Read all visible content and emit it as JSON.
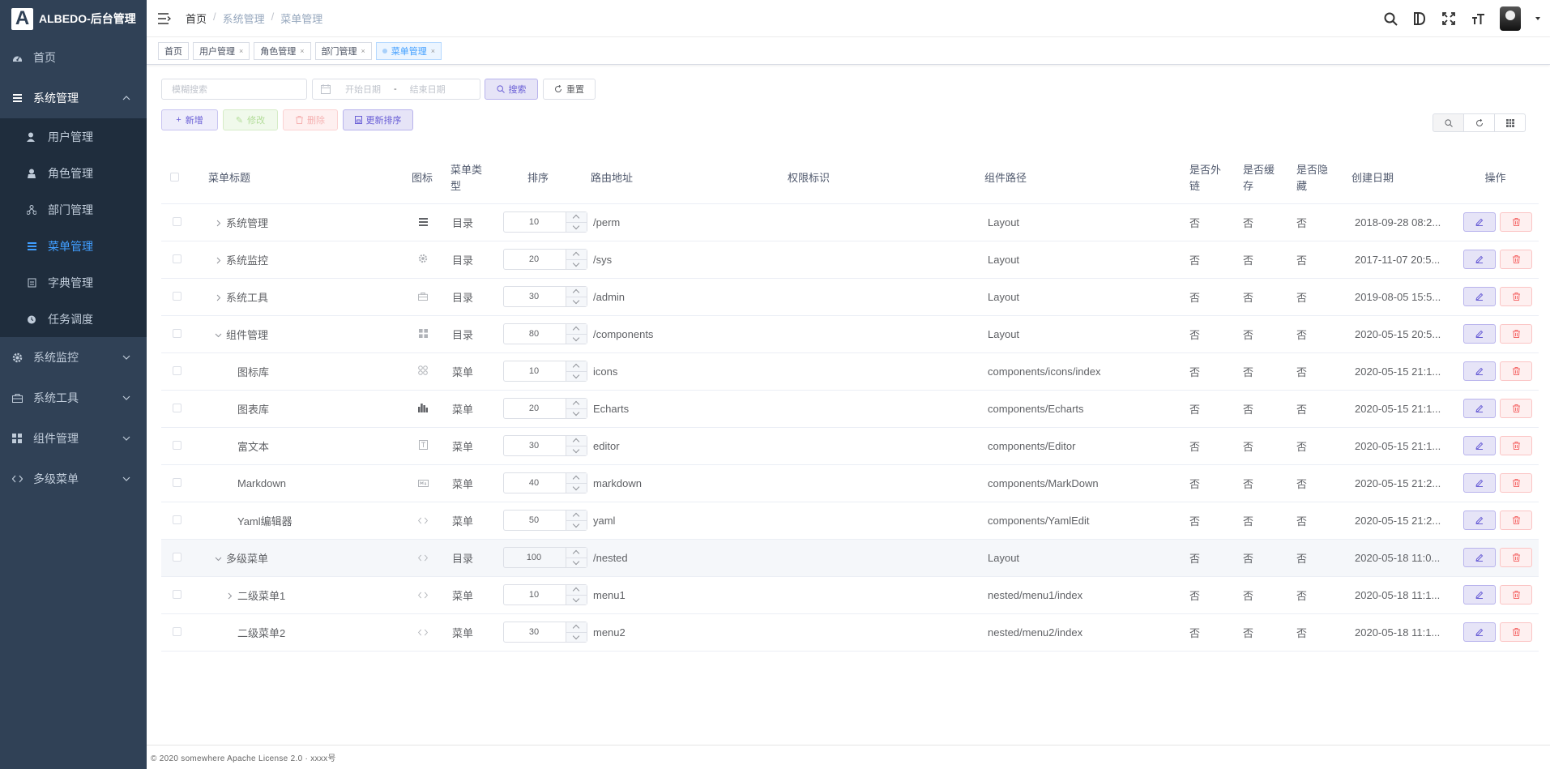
{
  "app": {
    "logo_letter": "A",
    "title": "ALBEDO-后台管理"
  },
  "sidebar": {
    "items": [
      {
        "label": "首页",
        "icon": "dashboard-icon"
      },
      {
        "label": "系统管理",
        "icon": "system-icon",
        "expanded": true
      },
      {
        "label": "系统监控",
        "icon": "monitor-icon"
      },
      {
        "label": "系统工具",
        "icon": "tools-icon"
      },
      {
        "label": "组件管理",
        "icon": "components-icon"
      },
      {
        "label": "多级菜单",
        "icon": "code-icon"
      }
    ],
    "sub_items": [
      {
        "label": "用户管理",
        "icon": "user-icon"
      },
      {
        "label": "角色管理",
        "icon": "role-icon"
      },
      {
        "label": "部门管理",
        "icon": "dept-icon"
      },
      {
        "label": "菜单管理",
        "icon": "menu-icon",
        "active": true
      },
      {
        "label": "字典管理",
        "icon": "dict-icon"
      },
      {
        "label": "任务调度",
        "icon": "timer-icon"
      }
    ]
  },
  "breadcrumb": {
    "home": "首页",
    "level1": "系统管理",
    "level2": "菜单管理"
  },
  "tags": [
    {
      "label": "首页",
      "closable": false
    },
    {
      "label": "用户管理",
      "closable": true
    },
    {
      "label": "角色管理",
      "closable": true
    },
    {
      "label": "部门管理",
      "closable": true
    },
    {
      "label": "菜单管理",
      "closable": true,
      "active": true
    }
  ],
  "filter": {
    "search_placeholder": "模糊搜索",
    "start_date_placeholder": "开始日期",
    "date_sep": "-",
    "end_date_placeholder": "结束日期",
    "search_btn": "搜索",
    "reset_btn": "重置"
  },
  "crud": {
    "add": "新增",
    "edit": "修改",
    "delete": "删除",
    "update_sort": "更新排序"
  },
  "table": {
    "headers": {
      "title": "菜单标题",
      "icon": "图标",
      "type": "菜单类型",
      "sort": "排序",
      "path": "路由地址",
      "permission": "权限标识",
      "component": "组件路径",
      "iframe": "是否外链",
      "cache": "是否缓存",
      "hidden": "是否隐藏",
      "created": "创建日期",
      "ops": "操作"
    },
    "rows": [
      {
        "title": "系统管理",
        "level": 0,
        "arrow": "right",
        "icon": "system-icon",
        "type": "目录",
        "sort": "10",
        "path": "/perm",
        "permission": "",
        "component": "Layout",
        "iframe": "否",
        "cache": "否",
        "hidden": "否",
        "created": "2018-09-28 08:2..."
      },
      {
        "title": "系统监控",
        "level": 0,
        "arrow": "right",
        "icon": "monitor-icon",
        "type": "目录",
        "sort": "20",
        "path": "/sys",
        "permission": "",
        "component": "Layout",
        "iframe": "否",
        "cache": "否",
        "hidden": "否",
        "created": "2017-11-07 20:5..."
      },
      {
        "title": "系统工具",
        "level": 0,
        "arrow": "right",
        "icon": "tools-icon",
        "type": "目录",
        "sort": "30",
        "path": "/admin",
        "permission": "",
        "component": "Layout",
        "iframe": "否",
        "cache": "否",
        "hidden": "否",
        "created": "2019-08-05 15:5..."
      },
      {
        "title": "组件管理",
        "level": 0,
        "arrow": "down",
        "icon": "components-icon",
        "type": "目录",
        "sort": "80",
        "path": "/components",
        "permission": "",
        "component": "Layout",
        "iframe": "否",
        "cache": "否",
        "hidden": "否",
        "created": "2020-05-15 20:5..."
      },
      {
        "title": "图标库",
        "level": 1,
        "arrow": "",
        "icon": "icons-icon",
        "type": "菜单",
        "sort": "10",
        "path": "icons",
        "permission": "",
        "component": "components/icons/index",
        "iframe": "否",
        "cache": "否",
        "hidden": "否",
        "created": "2020-05-15 21:1..."
      },
      {
        "title": "图表库",
        "level": 1,
        "arrow": "",
        "icon": "chart-icon",
        "type": "菜单",
        "sort": "20",
        "path": "Echarts",
        "permission": "",
        "component": "components/Echarts",
        "iframe": "否",
        "cache": "否",
        "hidden": "否",
        "created": "2020-05-15 21:1..."
      },
      {
        "title": "富文本",
        "level": 1,
        "arrow": "",
        "icon": "editor-icon",
        "type": "菜单",
        "sort": "30",
        "path": "editor",
        "permission": "",
        "component": "components/Editor",
        "iframe": "否",
        "cache": "否",
        "hidden": "否",
        "created": "2020-05-15 21:1..."
      },
      {
        "title": "Markdown",
        "level": 1,
        "arrow": "",
        "icon": "markdown-icon",
        "type": "菜单",
        "sort": "40",
        "path": "markdown",
        "permission": "",
        "component": "components/MarkDown",
        "iframe": "否",
        "cache": "否",
        "hidden": "否",
        "created": "2020-05-15 21:2..."
      },
      {
        "title": "Yaml编辑器",
        "level": 1,
        "arrow": "",
        "icon": "code-icon",
        "type": "菜单",
        "sort": "50",
        "path": "yaml",
        "permission": "",
        "component": "components/YamlEdit",
        "iframe": "否",
        "cache": "否",
        "hidden": "否",
        "created": "2020-05-15 21:2..."
      },
      {
        "title": "多级菜单",
        "level": 0,
        "arrow": "down",
        "icon": "code-icon",
        "type": "目录",
        "sort": "100",
        "path": "/nested",
        "permission": "",
        "component": "Layout",
        "iframe": "否",
        "cache": "否",
        "hidden": "否",
        "created": "2020-05-18 11:0...",
        "highlight": true
      },
      {
        "title": "二级菜单1",
        "level": 1,
        "arrow": "right",
        "icon": "code-icon",
        "type": "菜单",
        "sort": "10",
        "path": "menu1",
        "permission": "",
        "component": "nested/menu1/index",
        "iframe": "否",
        "cache": "否",
        "hidden": "否",
        "created": "2020-05-18 11:1..."
      },
      {
        "title": "二级菜单2",
        "level": 1,
        "arrow": "",
        "icon": "code-icon",
        "type": "菜单",
        "sort": "30",
        "path": "menu2",
        "permission": "",
        "component": "nested/menu2/index",
        "iframe": "否",
        "cache": "否",
        "hidden": "否",
        "created": "2020-05-18 11:1..."
      }
    ]
  },
  "footer": {
    "text": "© 2020 somewhere Apache License 2.0 · xxxx号"
  },
  "colors": {
    "sidebar_bg": "#304156",
    "submenu_bg": "#1f2d3d",
    "active": "#409eff",
    "primary": "#6a5fd6",
    "danger": "#f56c6c"
  }
}
